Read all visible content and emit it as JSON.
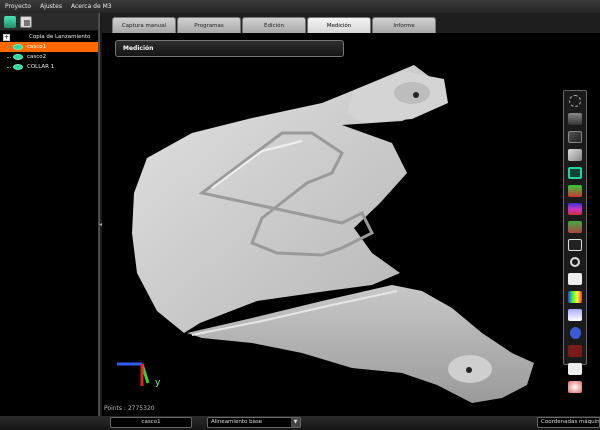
{
  "menu": {
    "items": [
      "Proyecto",
      "Ajustes",
      "Acerca de M3"
    ]
  },
  "tree": {
    "root_label": "Copia de Lanzamiento",
    "root_expander": "+",
    "items": [
      {
        "label": "casco1",
        "selected": true
      },
      {
        "label": "casco2",
        "selected": false
      },
      {
        "label": "COLLAR 1",
        "selected": false
      }
    ]
  },
  "tabs": [
    {
      "label": "Captura manual",
      "active": false
    },
    {
      "label": "Programas",
      "active": false
    },
    {
      "label": "Edición",
      "active": false
    },
    {
      "label": "Medición",
      "active": true
    },
    {
      "label": "Informe",
      "active": false
    }
  ],
  "viewport": {
    "panel_title": "Medición",
    "points_text": "Points : 2775320"
  },
  "axes": {
    "y_label": "y"
  },
  "status": {
    "object": "casco1",
    "alignment": "Alineamiento base",
    "alignment_arrow": "▼",
    "coords": "Coordenadas máquina"
  },
  "colors": {
    "accent_selected": "#ff6a00",
    "mesh_icon": "#2fd69c",
    "model_surface": "#d8d8d8"
  },
  "right_toolbar_icons": [
    "transparency-icon",
    "view-mode-icon",
    "clipping-icon",
    "smooth-icon",
    "mesh-select-icon",
    "color-map-icon",
    "deviation-map-icon",
    "section-icon",
    "fit-view-icon",
    "zoom-icon",
    "screenshot-icon",
    "color-scale-icon",
    "layers-icon",
    "settings-icon",
    "texture-icon",
    "solid-icon",
    "light-icon"
  ]
}
